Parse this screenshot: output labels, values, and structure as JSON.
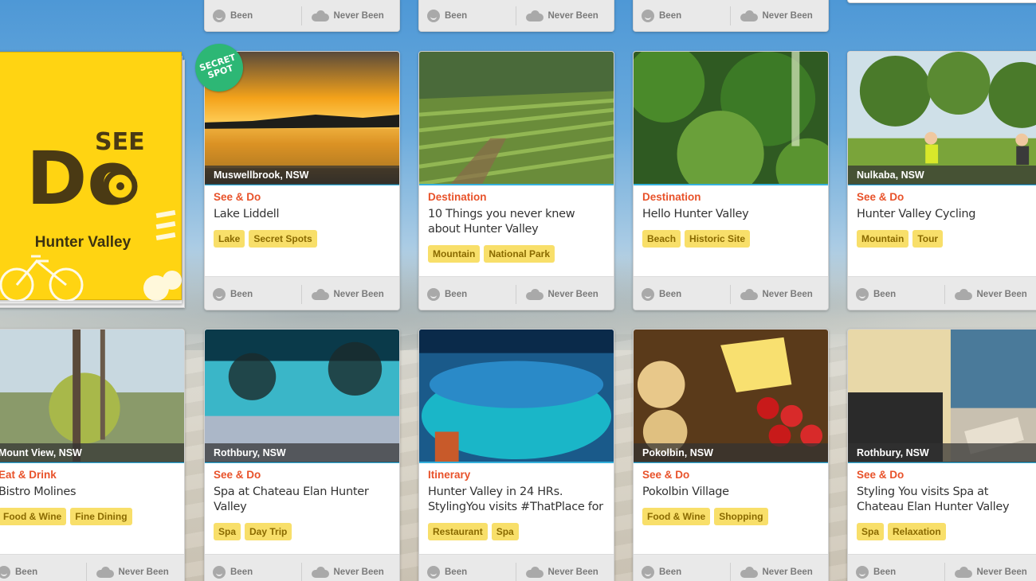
{
  "action_labels": {
    "been": "Been",
    "never_been": "Never Been"
  },
  "feature_card": {
    "logo_small": "SEE",
    "logo_big": "Do",
    "name": "Hunter Valley"
  },
  "badge": {
    "line1": "SECRET",
    "line2": "SPOT"
  },
  "row1": [
    {
      "location": "Muswellbrook, NSW",
      "category": "See & Do",
      "title": "Lake Liddell",
      "tags": [
        "Lake",
        "Secret Spots"
      ]
    },
    {
      "location": "",
      "category": "Destination",
      "title": "10 Things you never knew about Hunter Valley",
      "tags": [
        "Mountain",
        "National Park"
      ]
    },
    {
      "location": "",
      "category": "Destination",
      "title": "Hello Hunter Valley",
      "tags": [
        "Beach",
        "Historic Site"
      ]
    },
    {
      "location": "Nulkaba, NSW",
      "category": "See & Do",
      "title": "Hunter Valley Cycling",
      "tags": [
        "Mountain",
        "Tour"
      ]
    }
  ],
  "row2": [
    {
      "location": "Mount View, NSW",
      "category": "Eat & Drink",
      "title": "Bistro Molines",
      "tags": [
        "Food & Wine",
        "Fine Dining"
      ]
    },
    {
      "location": "Rothbury, NSW",
      "category": "See & Do",
      "title": "Spa at Chateau Elan Hunter Valley",
      "tags": [
        "Spa",
        "Day Trip"
      ]
    },
    {
      "location": "",
      "category": "Itinerary",
      "title": "Hunter Valley in 24 HRs. StylingYou visits #ThatPlace for",
      "tags": [
        "Restaurant",
        "Spa"
      ]
    },
    {
      "location": "Pokolbin, NSW",
      "category": "See & Do",
      "title": "Pokolbin Village",
      "tags": [
        "Food & Wine",
        "Shopping"
      ]
    },
    {
      "location": "Rothbury, NSW",
      "category": "See & Do",
      "title": "Styling You visits Spa at Chateau Elan Hunter Valley",
      "tags": [
        "Spa",
        "Relaxation"
      ]
    }
  ],
  "colors": {
    "accent_line": "#35b0dc",
    "category": "#e8522a",
    "tag_bg": "#f8df6a",
    "feature_bg": "#ffd412",
    "badge": "#2db775"
  }
}
